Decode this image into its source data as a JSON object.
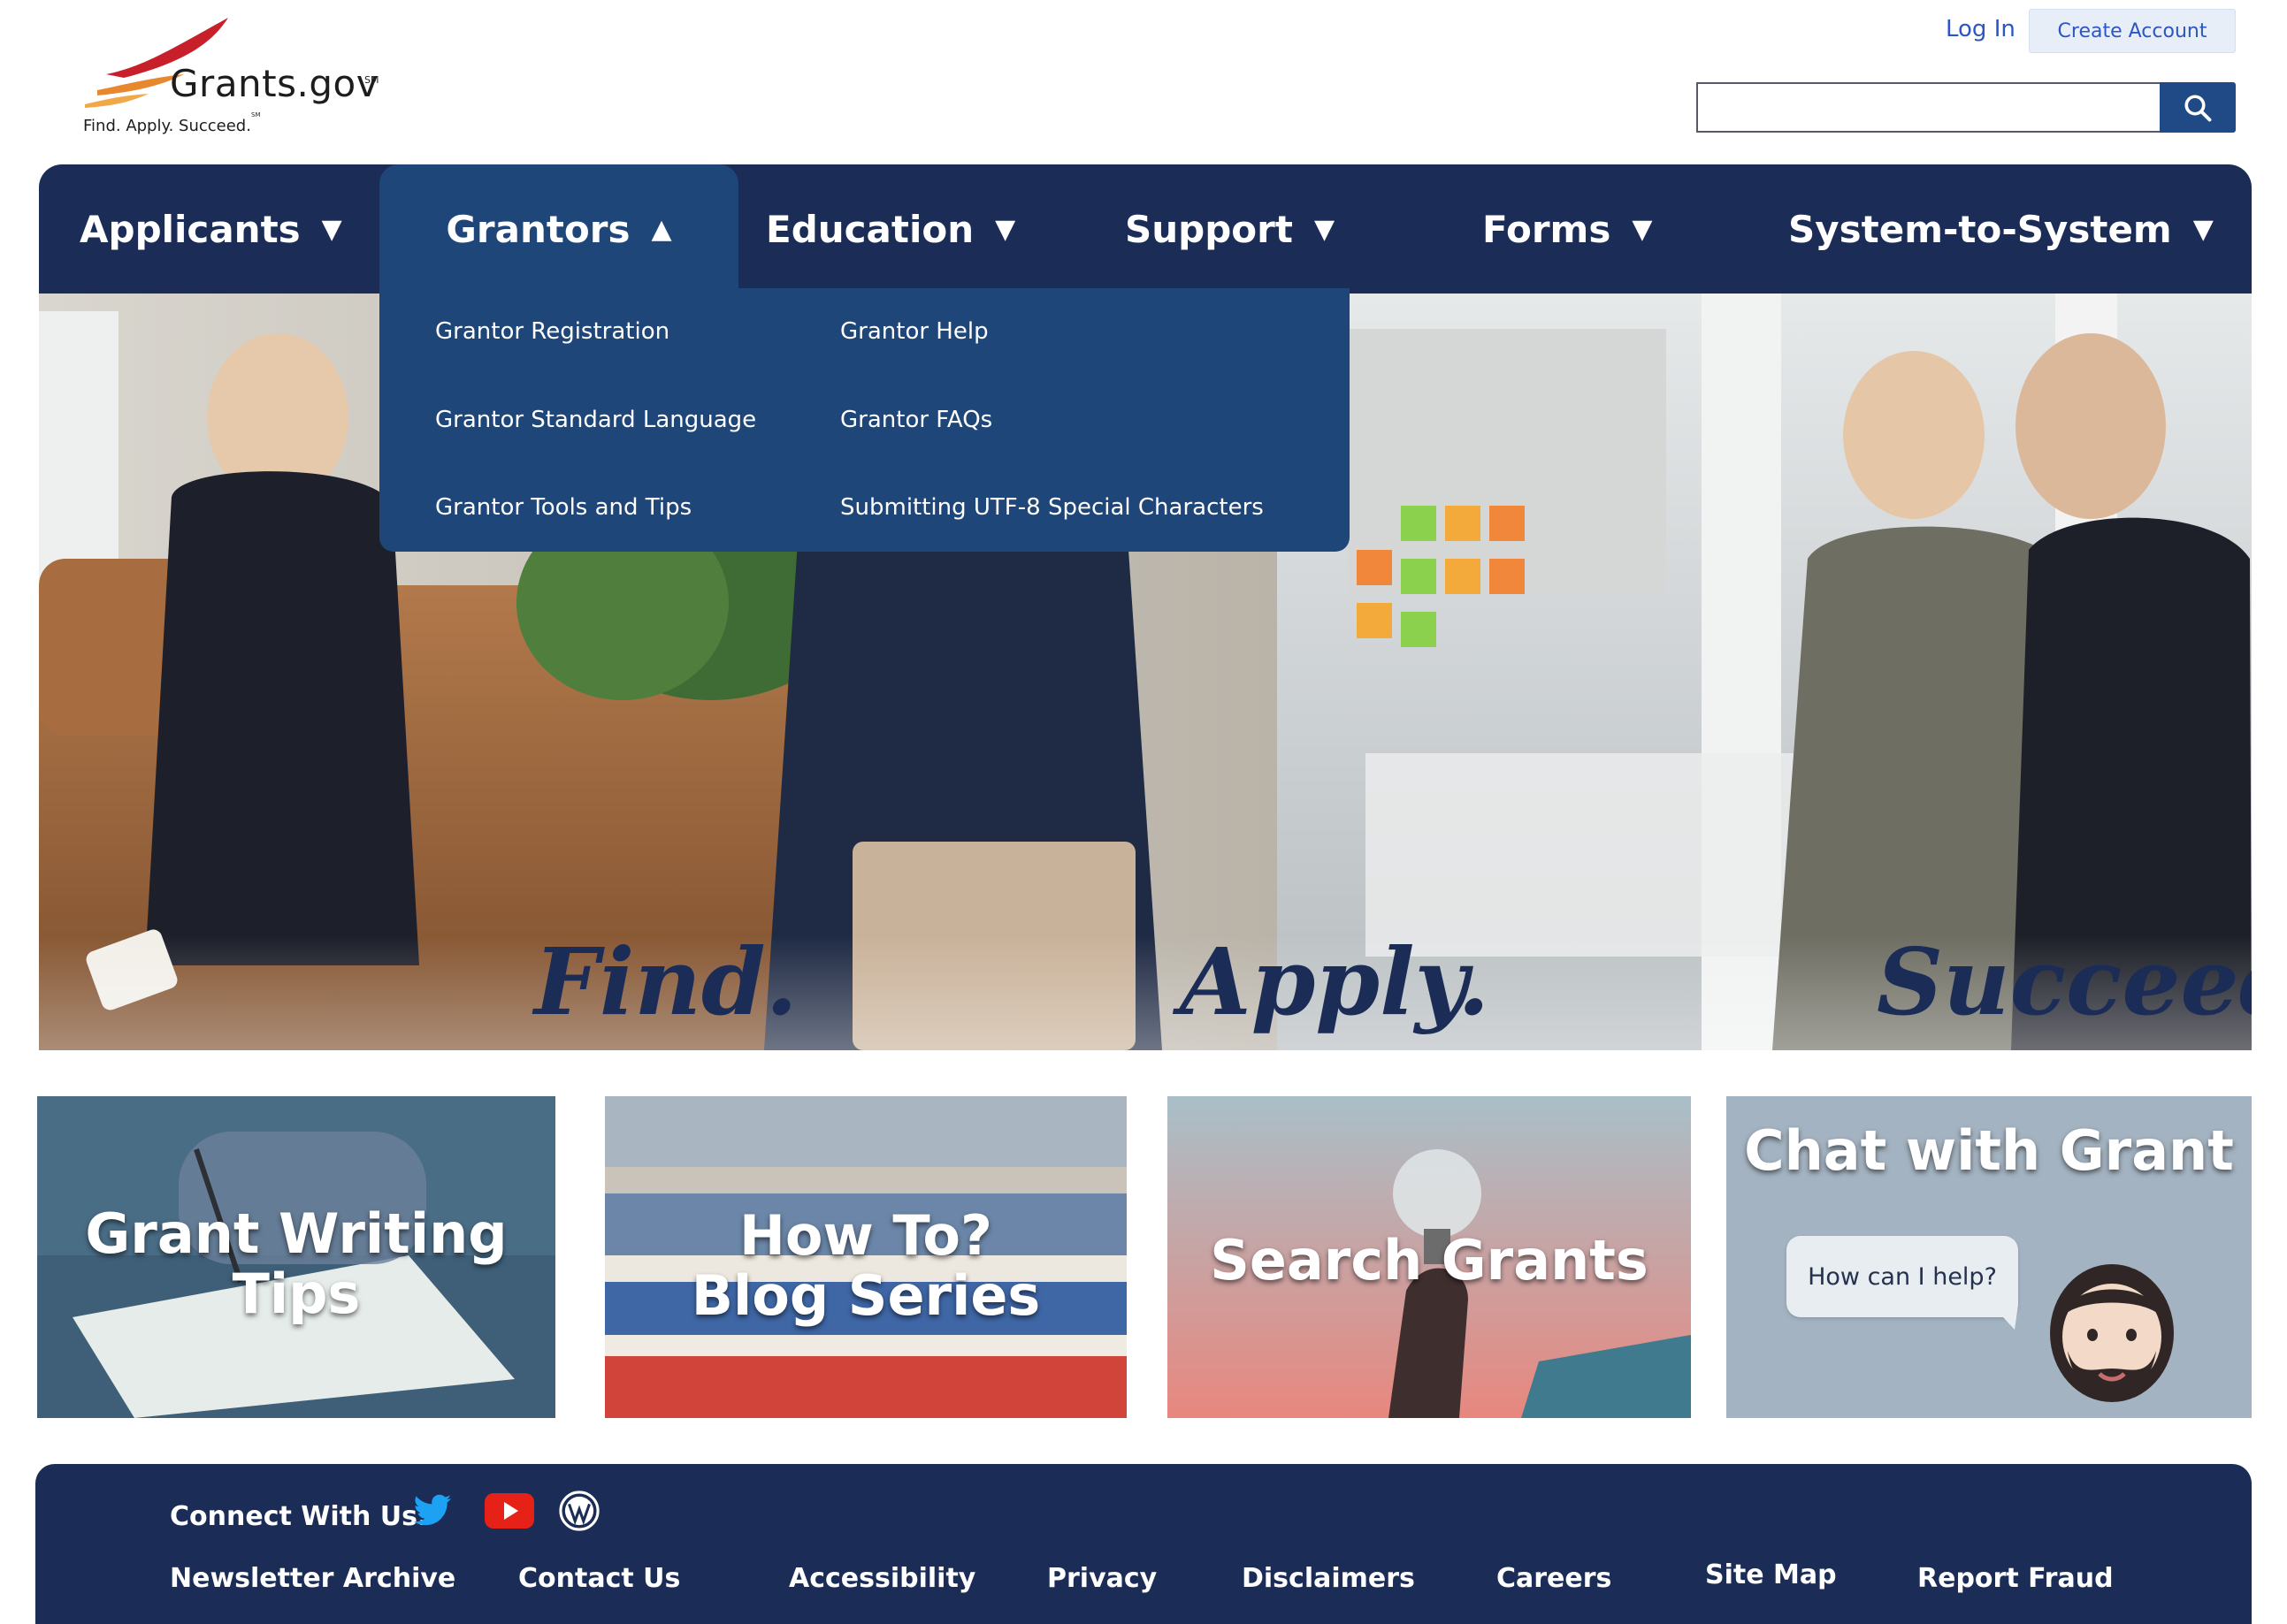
{
  "logo": {
    "wordmark": "Grants.gov",
    "service_mark": "SM",
    "tagline": "Find. Apply. Succeed.",
    "tagline_mark": "SM"
  },
  "header": {
    "login_label": "Log In",
    "create_account_label": "Create Account",
    "search_value": "",
    "search_icon": "search-icon"
  },
  "nav": {
    "items": [
      {
        "label": "Applicants",
        "arrow": "▼"
      },
      {
        "label": "Grantors",
        "arrow": "▲"
      },
      {
        "label": "Education",
        "arrow": "▼"
      },
      {
        "label": "Support",
        "arrow": "▼"
      },
      {
        "label": "Forms",
        "arrow": "▼"
      },
      {
        "label": "System-to-System",
        "arrow": "▼"
      }
    ],
    "active": "Grantors"
  },
  "dropdown": {
    "col1": [
      "Grantor Registration",
      "Grantor Standard Language",
      "Grantor Tools and Tips"
    ],
    "col2": [
      "Grantor Help",
      "Grantor FAQs",
      "Submitting UTF-8 Special Characters"
    ]
  },
  "hero": {
    "words": [
      "Find.",
      "Apply.",
      "Succeed."
    ]
  },
  "cards": {
    "grant_writing": {
      "line1": "Grant Writing",
      "line2": "Tips"
    },
    "how_to": {
      "line1": "How To?",
      "line2": "Blog Series"
    },
    "search_grants": {
      "title": "Search Grants"
    },
    "chat": {
      "title": "Chat with Grant",
      "bubble": "How can I help?"
    }
  },
  "footer": {
    "connect_label": "Connect With Us:",
    "social_icons": [
      "twitter-icon",
      "youtube-icon",
      "wordpress-icon"
    ],
    "links": [
      "Newsletter Archive",
      "Contact Us",
      "Accessibility",
      "Privacy",
      "Disclaimers",
      "Careers",
      "Site Map",
      "Report Fraud"
    ]
  },
  "colors": {
    "navy": "#1b2d56",
    "active_blue": "#1f4679",
    "link_blue": "#2b56c4"
  }
}
